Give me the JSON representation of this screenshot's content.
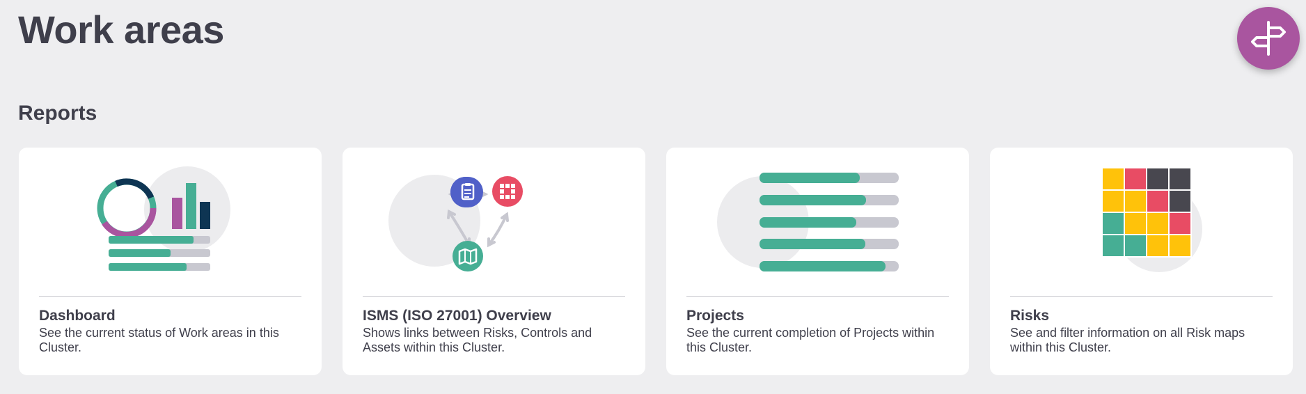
{
  "page": {
    "title": "Work areas"
  },
  "section": {
    "title": "Reports"
  },
  "fab": {
    "icon": "signpost-icon",
    "color": "#a9559f"
  },
  "colors": {
    "green": "#46ae94",
    "purple": "#a9559f",
    "navy": "#0e3553",
    "red": "#e84c64",
    "blue": "#5060c8",
    "yellow": "#ffc20a",
    "dark": "#48474f",
    "gray": "#c8c8d0",
    "circle": "#ececee"
  },
  "cards": [
    {
      "title": "Dashboard",
      "description": "See the current status of Work areas in this Cluster.",
      "icon": "dashboard-chart-icon"
    },
    {
      "title": "ISMS (ISO 27001) Overview",
      "description": "Shows links between Risks, Controls and Assets within this Cluster.",
      "icon": "isms-network-icon"
    },
    {
      "title": "Projects",
      "description": "See the current completion of Projects within this Cluster.",
      "icon": "project-bars-icon"
    },
    {
      "title": "Risks",
      "description": "See and filter information on all Risk maps within this Cluster.",
      "icon": "risk-map-icon"
    }
  ]
}
